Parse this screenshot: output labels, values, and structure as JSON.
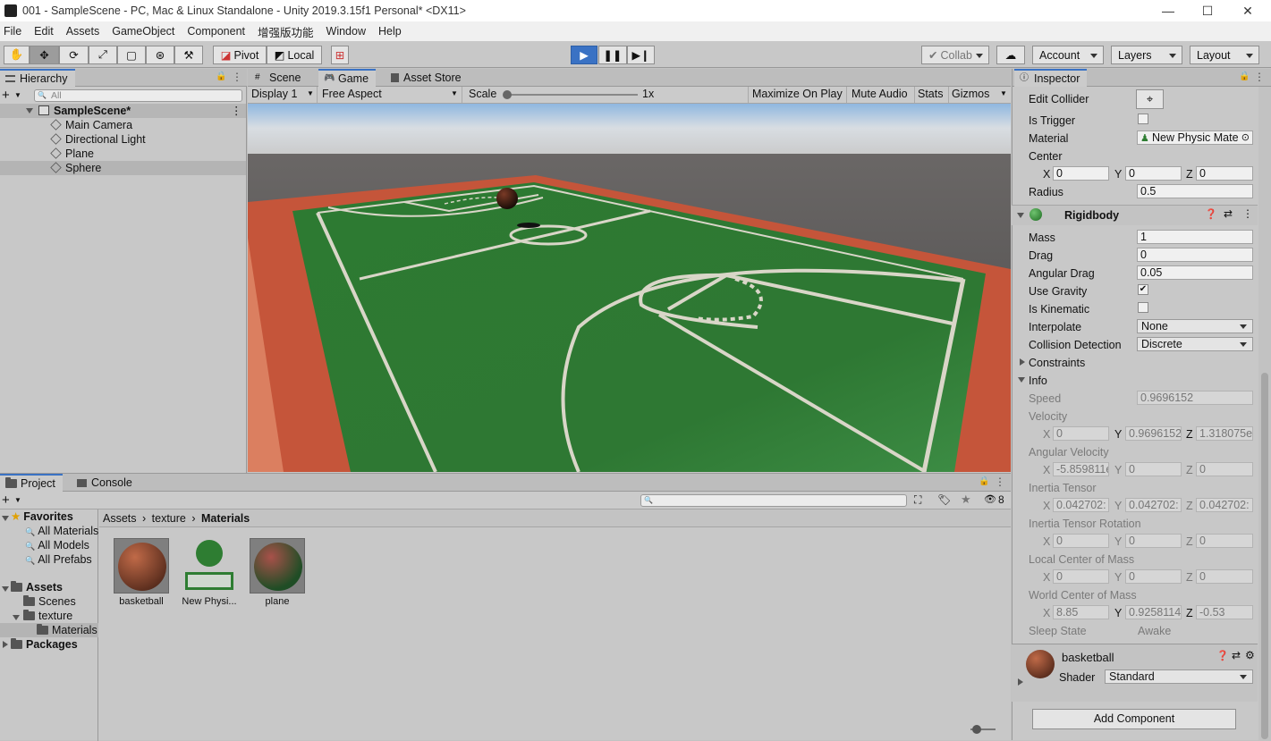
{
  "window": {
    "title": "001 - SampleScene - PC, Mac & Linux Standalone - Unity 2019.3.15f1 Personal* <DX11>"
  },
  "menu": [
    "File",
    "Edit",
    "Assets",
    "GameObject",
    "Component",
    "增强版功能",
    "Window",
    "Help"
  ],
  "toolbar": {
    "pivot": "Pivot",
    "local": "Local",
    "collab": "Collab",
    "account": "Account",
    "layers": "Layers",
    "layout": "Layout"
  },
  "hierarchy": {
    "tab": "Hierarchy",
    "search_placeholder": "All",
    "scene": "SampleScene*",
    "objects": [
      "Main Camera",
      "Directional Light",
      "Plane",
      "Sphere"
    ]
  },
  "center_tabs": [
    "Scene",
    "Game",
    "Asset Store"
  ],
  "game_bar": {
    "display": "Display 1",
    "aspect": "Free Aspect",
    "scale_label": "Scale",
    "scale_value": "1x",
    "maximize": "Maximize On Play",
    "mute": "Mute Audio",
    "stats": "Stats",
    "gizmos": "Gizmos"
  },
  "inspector": {
    "tab": "Inspector",
    "collider": {
      "edit_collider": "Edit Collider",
      "is_trigger": "Is Trigger",
      "material_label": "Material",
      "material_value": "New Physic Mate",
      "center": "Center",
      "cx": "0",
      "cy": "0",
      "cz": "0",
      "radius_label": "Radius",
      "radius": "0.5"
    },
    "rigidbody": {
      "title": "Rigidbody",
      "mass_label": "Mass",
      "mass": "1",
      "drag_label": "Drag",
      "drag": "0",
      "angular_drag_label": "Angular Drag",
      "angular_drag": "0.05",
      "use_gravity": "Use Gravity",
      "is_kinematic": "Is Kinematic",
      "interpolate_label": "Interpolate",
      "interpolate": "None",
      "collision_label": "Collision Detection",
      "collision": "Discrete",
      "constraints": "Constraints",
      "info": "Info",
      "speed_label": "Speed",
      "speed": "0.9696152",
      "velocity_label": "Velocity",
      "vx": "0",
      "vy": "0.9696152",
      "vz": "1.318075e",
      "ang_vel_label": "Angular Velocity",
      "avx": "-5.859811e",
      "avy": "0",
      "avz": "0",
      "inertia_label": "Inertia Tensor",
      "itx": "0.042702:",
      "ity": "0.042702:",
      "itz": "0.042702:",
      "inertia_rot_label": "Inertia Tensor Rotation",
      "irx": "0",
      "iry": "0",
      "irz": "0",
      "local_com_label": "Local Center of Mass",
      "lcx": "0",
      "lcy": "0",
      "lcz": "0",
      "world_com_label": "World Center of Mass",
      "wcx": "8.85",
      "wcy": "0.9258114",
      "wcz": "-0.53",
      "sleep_label": "Sleep State",
      "sleep": "Awake"
    },
    "material": {
      "name": "basketball",
      "shader_label": "Shader",
      "shader": "Standard"
    },
    "add_component": "Add Component"
  },
  "project": {
    "tabs": [
      "Project",
      "Console"
    ],
    "hidden_count": "8",
    "favorites": "Favorites",
    "fav_items": [
      "All Materials",
      "All Models",
      "All Prefabs"
    ],
    "assets": "Assets",
    "scenes": "Scenes",
    "texture": "texture",
    "materials": "Materials",
    "packages": "Packages",
    "breadcrumb": [
      "Assets",
      "texture",
      "Materials"
    ],
    "items": [
      "basketball",
      "New Physi...",
      "plane"
    ]
  },
  "colors": {
    "accent": "#3a72c4",
    "court": "#2f7a34",
    "border": "#c5553a",
    "play": "#3a72c4"
  }
}
